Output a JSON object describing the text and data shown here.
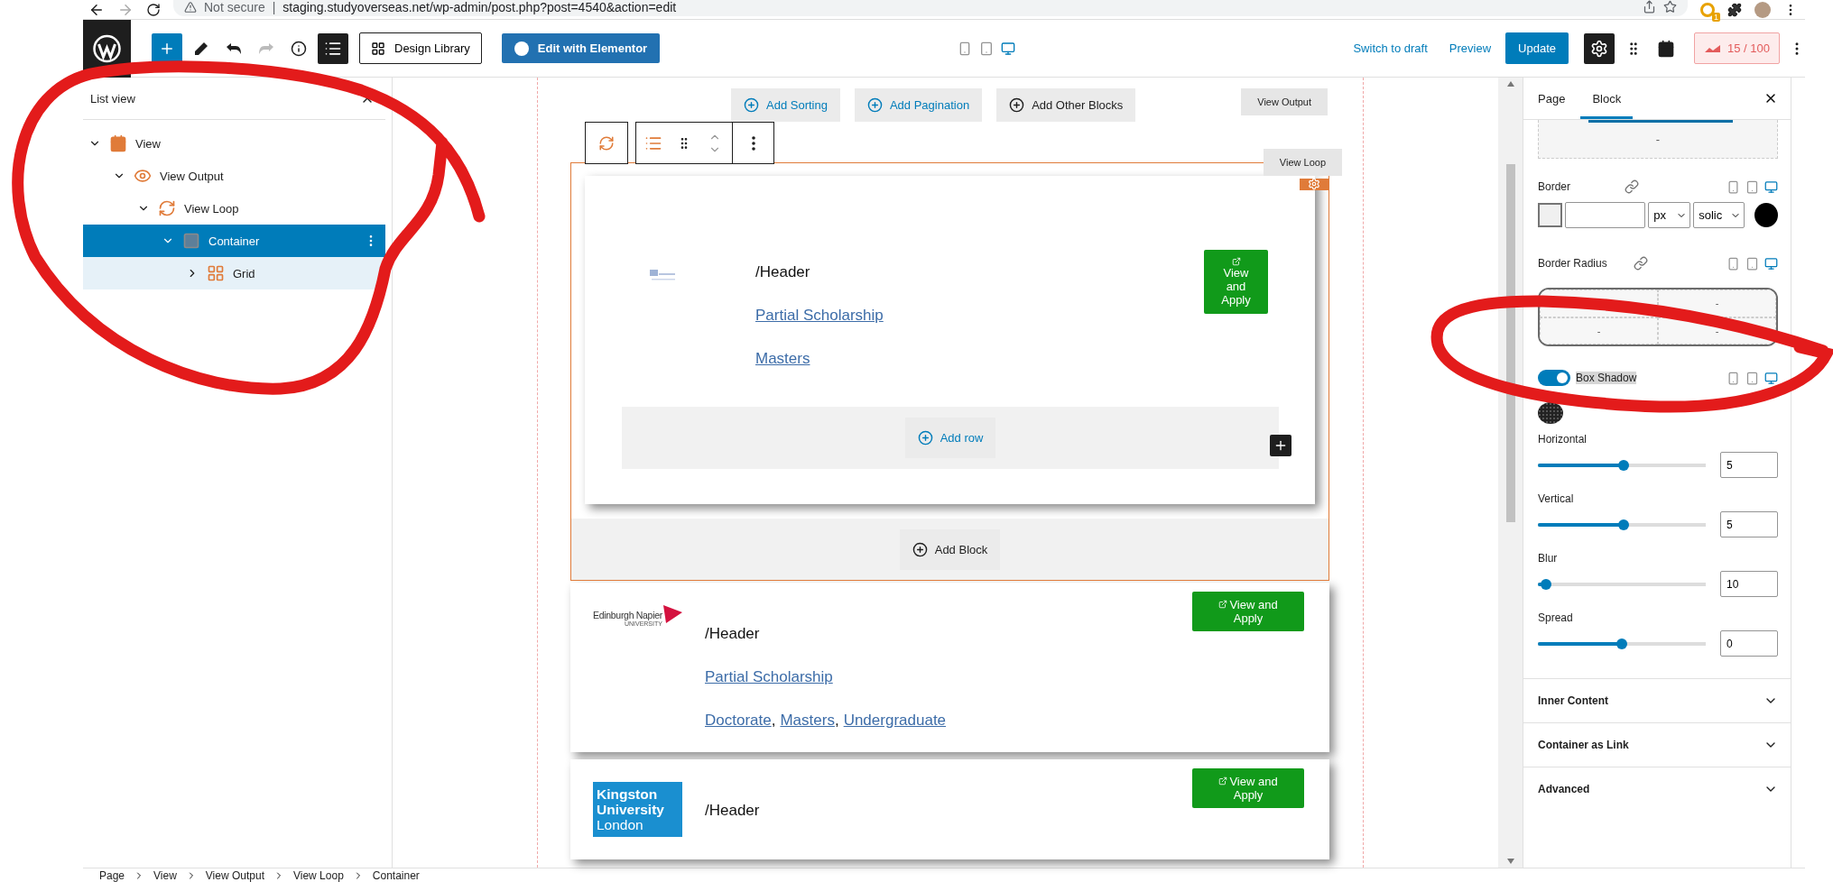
{
  "browser": {
    "security": "Not secure",
    "separator": "|",
    "url": "staging.studyoverseas.net/wp-admin/post.php?post=4540&action=edit",
    "extension_badge": "1"
  },
  "toolbar": {
    "list_view_open": true,
    "design_library": "Design Library",
    "edit_with": "Edit with Elementor",
    "devices": [
      {
        "kind": "mobile",
        "selected": false
      },
      {
        "kind": "tablet",
        "selected": false
      },
      {
        "kind": "desktop",
        "selected": true
      }
    ],
    "switch_to_draft": "Switch to draft",
    "preview": "Preview",
    "update": "Update",
    "settings_open": true,
    "score": "15 / 100"
  },
  "list_view": {
    "title": "List view",
    "items": [
      {
        "label": "View",
        "kind": "view",
        "expanded": true,
        "selected": false,
        "children": [
          {
            "label": "View Output",
            "kind": "output",
            "expanded": true,
            "selected": false,
            "children": [
              {
                "label": "View Loop",
                "kind": "loop",
                "expanded": true,
                "selected": false,
                "children": [
                  {
                    "label": "Container",
                    "kind": "container",
                    "expanded": true,
                    "selected": true,
                    "children": [
                      {
                        "label": "Grid",
                        "kind": "grid",
                        "expanded": false,
                        "selected": false
                      }
                    ]
                  }
                ]
              }
            ]
          }
        ]
      }
    ]
  },
  "canvas": {
    "actions": [
      "Add Sorting",
      "Add Pagination",
      "Add Other Blocks"
    ],
    "view_output_tag": "View Output",
    "view_loop_tag": "View Loop",
    "add_row": "Add row",
    "add_block": "Add Block",
    "cards": [
      {
        "kind": "template",
        "logo": {
          "kind": "thumbnail"
        },
        "header": "/Header",
        "scholarship": "Partial Scholarship",
        "levels": [
          "Masters"
        ],
        "button": "View and Apply"
      },
      {
        "kind": "preview",
        "logo": {
          "kind": "napier",
          "lines": [
            "Edinburgh Napier",
            "UNIVERSITY"
          ]
        },
        "header": "/Header",
        "scholarship": "Partial Scholarship",
        "levels": [
          "Doctorate",
          "Masters",
          "Undergraduate"
        ],
        "level_separator": ",",
        "button": "View and Apply"
      },
      {
        "kind": "preview",
        "logo": {
          "kind": "kingston",
          "lines": [
            "Kingston",
            "University",
            "London"
          ]
        },
        "header": "/Header",
        "button": "View and Apply"
      }
    ]
  },
  "sidebar": {
    "tabs": [
      {
        "label": "Page",
        "selected": false
      },
      {
        "label": "Block",
        "selected": true
      }
    ],
    "top_box": "-",
    "border": {
      "label": "Border",
      "unit": "px",
      "style": "solic"
    },
    "radius": {
      "label": "Border Radius",
      "cells": [
        {},
        {
          "text": "-"
        },
        {
          "text": "-"
        },
        {
          "text": "-"
        }
      ]
    },
    "box_shadow": {
      "label": "Box Shadow",
      "on": true
    },
    "sliders": [
      {
        "label": "Horizontal",
        "level": 0.51,
        "value": "5"
      },
      {
        "label": "Vertical",
        "level": 0.51,
        "value": "5"
      },
      {
        "label": "Blur",
        "level": 0.05,
        "value": "10"
      },
      {
        "label": "Spread",
        "level": 0.5,
        "value": "0"
      }
    ],
    "sections": [
      {
        "label": "Inner Content",
        "expanded": false
      },
      {
        "label": "Container as Link",
        "expanded": false
      },
      {
        "label": "Advanced",
        "expanded": false
      }
    ]
  },
  "breadcrumb": [
    "Page",
    "View",
    "View Output",
    "View Loop",
    "Container"
  ]
}
